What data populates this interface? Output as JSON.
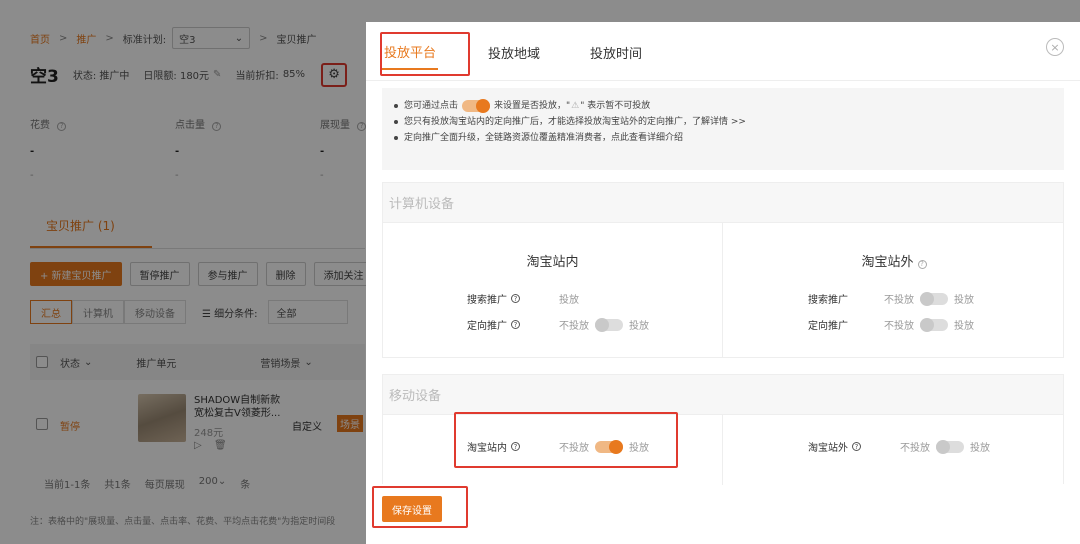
{
  "breadcrumb": {
    "home": "首页",
    "promo": "推广",
    "plan_label": "标准计划:",
    "plan_value": "空3",
    "current": "宝贝推广",
    "sep": ">"
  },
  "header": {
    "name": "空3",
    "status": "状态: 推广中",
    "budget": "日限额: 180元",
    "discount_label": "当前折扣:",
    "discount": "85%"
  },
  "metrics": [
    {
      "label": "花费",
      "v1": "-",
      "v2": "-"
    },
    {
      "label": "点击量",
      "v1": "-",
      "v2": "-"
    },
    {
      "label": "展现量",
      "v1": "-",
      "v2": "-"
    }
  ],
  "page_tab": "宝贝推广 (1)",
  "actions": {
    "add": "+ 新建宝贝推广",
    "pause": "暂停推广",
    "join": "参与推广",
    "delete": "删除",
    "follow": "添加关注"
  },
  "filters": {
    "all_btn": "汇总",
    "computer": "计算机",
    "mobile": "移动设备",
    "cond": "细分条件:",
    "all": "全部"
  },
  "table": {
    "status": "状态",
    "unit": "推广单元",
    "scene": "营销场景"
  },
  "row": {
    "status": "暂停",
    "title": "SHADOW自制新款 宽松复古V领菱形...",
    "price": "248元",
    "custom": "自定义",
    "tag": "场景"
  },
  "pager": {
    "range": "当前1-1条",
    "total": "共1条",
    "per_page": "每页展现",
    "size": "200",
    "unit": "条"
  },
  "footer_note": "注：表格中的\"展现量、点击量、点击率、花费、平均点击花费\"为指定时间段",
  "modal": {
    "tabs": [
      "投放平台",
      "投放地域",
      "投放时间"
    ],
    "close": "×",
    "info": {
      "line1_a": "您可通过点击",
      "line1_b": "来设置是否投放，\"",
      "line1_warn": "⚠",
      "line1_c": "\" 表示暂不可投放",
      "line2": "您只有投放淘宝站内的定向推广后，才能选择投放淘宝站外的定向推广，了解详情 >>",
      "line3": "定向推广全面升级，全链路资源位覆盖精准消费者，点此查看详细介绍"
    },
    "computer": {
      "title": "计算机设备",
      "inside": {
        "title": "淘宝站内",
        "search_label": "搜索推广",
        "search_state": "投放",
        "target_label": "定向推广",
        "target_off": "不投放",
        "target_on": "投放"
      },
      "outside": {
        "title": "淘宝站外",
        "search_label": "搜索推广",
        "search_off": "不投放",
        "search_on": "投放",
        "target_label": "定向推广",
        "target_off": "不投放",
        "target_on": "投放"
      }
    },
    "mobile": {
      "title": "移动设备",
      "inside": {
        "label": "淘宝站内",
        "off": "不投放",
        "on": "投放"
      },
      "outside": {
        "label": "淘宝站外",
        "off": "不投放",
        "on": "投放"
      }
    },
    "save": "保存设置"
  }
}
